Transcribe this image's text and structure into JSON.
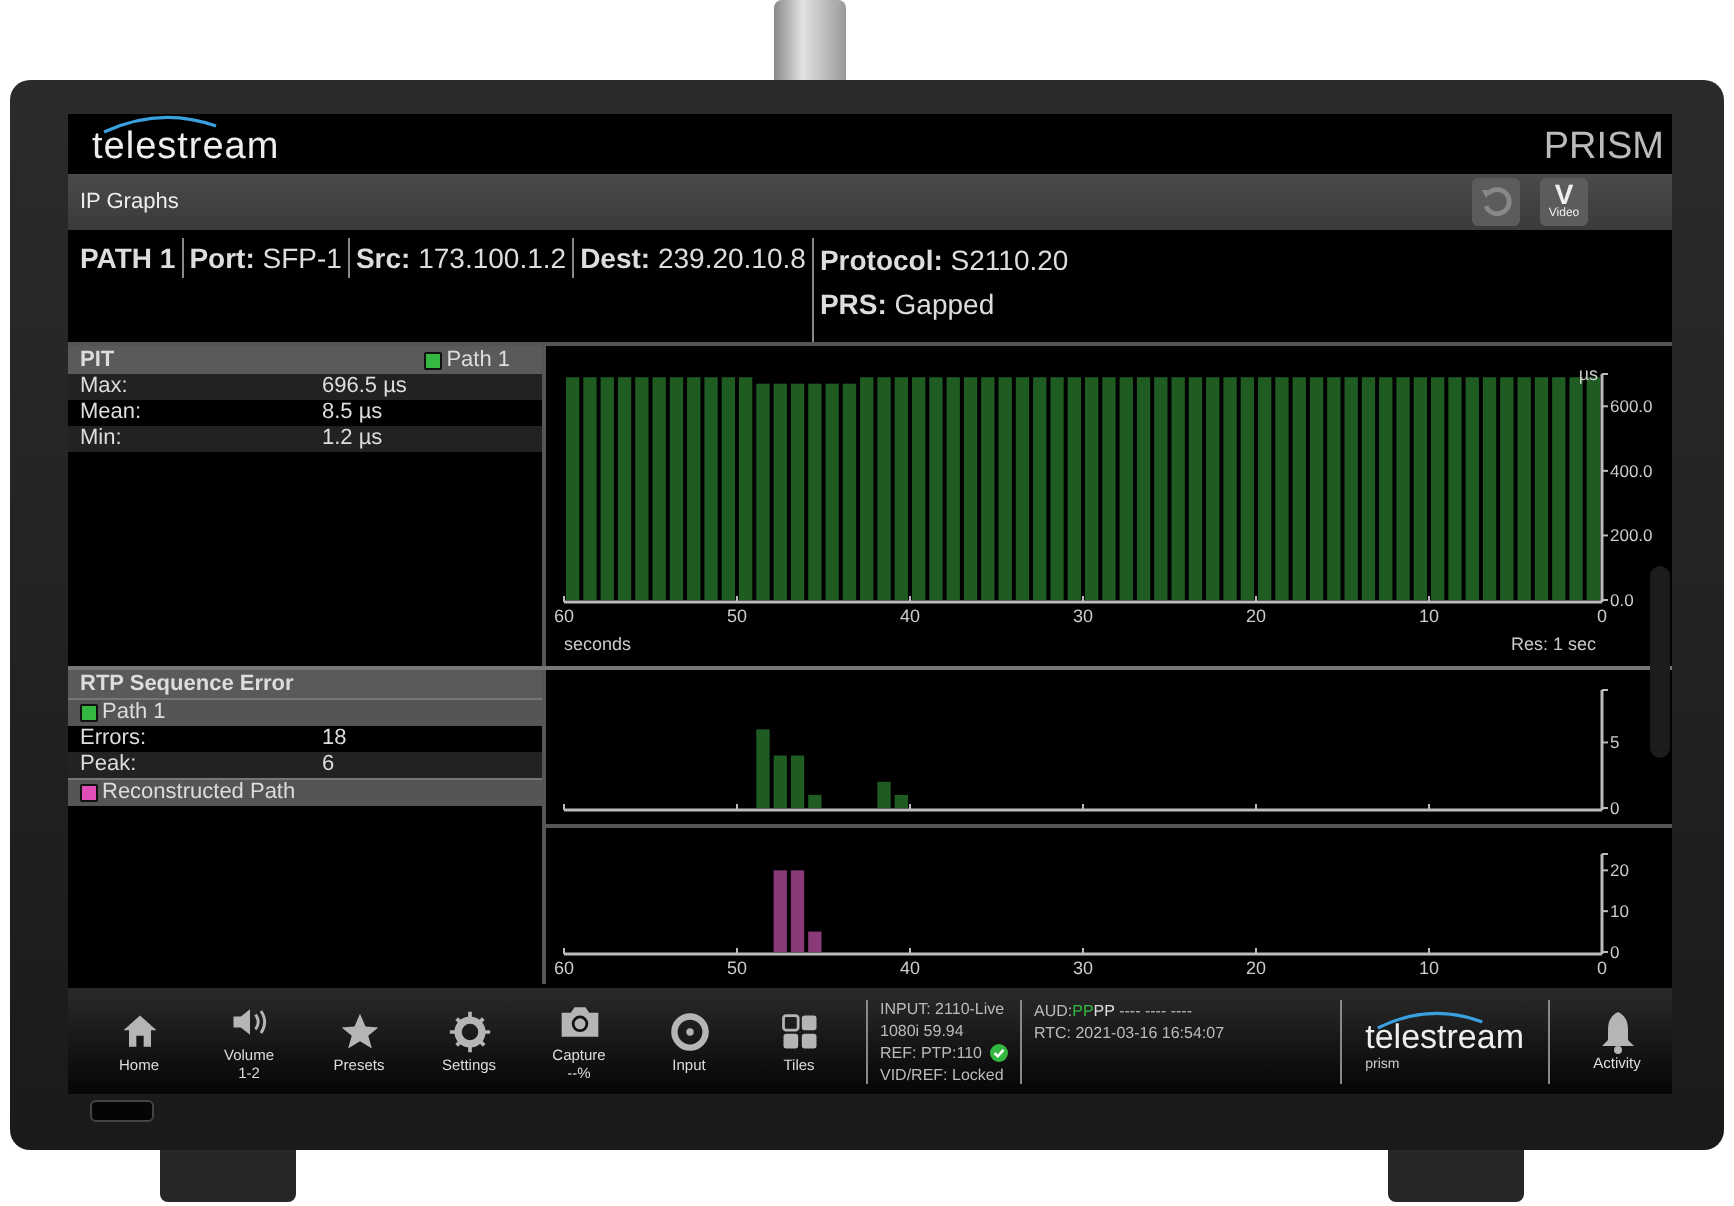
{
  "header": {
    "logo": "telestream",
    "product": "PRISM"
  },
  "title_bar": {
    "title": "IP Graphs",
    "buttons": [
      {
        "kind": "refresh"
      },
      {
        "kind": "video",
        "glyph": "V",
        "label": "Video"
      }
    ]
  },
  "info": {
    "path": "PATH 1",
    "fields": [
      "**Port:** SFP-1",
      "**Src:** 173.100.1.2",
      "**Dest:** 239.20.10.8"
    ],
    "details": [
      "**Protocol:** S2110.20",
      "**PRS:** Gapped"
    ]
  },
  "pit": {
    "title": "PIT",
    "legend": {
      "label": "Path 1",
      "color": "#35b83f"
    },
    "stats": [
      {
        "label": "Max:",
        "value": "696.5 µs"
      },
      {
        "label": "Mean:",
        "value": "8.5 µs"
      },
      {
        "label": "Min:",
        "value": "1.2 µs"
      }
    ],
    "resolution": "Res: 1 sec",
    "chart_data": {
      "type": "bar",
      "xlabel": "seconds",
      "ylabel": "µs",
      "xlim": [
        60,
        0
      ],
      "ylim": [
        0,
        700
      ],
      "xticks": [
        60,
        50,
        40,
        30,
        20,
        10,
        0
      ],
      "yticks": [
        {
          "value": 0,
          "label": "0.0"
        },
        {
          "value": 200,
          "label": "200.0"
        },
        {
          "value": 400,
          "label": "400.0"
        },
        {
          "value": 600,
          "label": "600.0"
        }
      ],
      "x": [
        59.5,
        58.5,
        57.5,
        56.5,
        55.5,
        54.5,
        53.5,
        52.5,
        51.5,
        50.5,
        49.5,
        48.5,
        47.5,
        46.5,
        45.5,
        44.5,
        43.5,
        42.5,
        41.5,
        40.5,
        39.5,
        38.5,
        37.5,
        36.5,
        35.5,
        34.5,
        33.5,
        32.5,
        31.5,
        30.5,
        29.5,
        28.5,
        27.5,
        26.5,
        25.5,
        24.5,
        23.5,
        22.5,
        21.5,
        20.5,
        19.5,
        18.5,
        17.5,
        16.5,
        15.5,
        14.5,
        13.5,
        12.5,
        11.5,
        10.5,
        9.5,
        8.5,
        7.5,
        6.5,
        5.5,
        4.5,
        3.5,
        2.5,
        1.5,
        0.5
      ],
      "series": [
        {
          "color": "#1e5c22",
          "values": [
            690,
            690,
            690,
            690,
            690,
            690,
            690,
            690,
            690,
            690,
            690,
            670,
            670,
            670,
            670,
            670,
            670,
            690,
            690,
            690,
            690,
            690,
            690,
            690,
            690,
            690,
            690,
            690,
            690,
            690,
            690,
            690,
            690,
            690,
            690,
            690,
            690,
            690,
            690,
            690,
            690,
            690,
            690,
            690,
            690,
            690,
            690,
            690,
            690,
            690,
            690,
            690,
            690,
            690,
            690,
            690,
            690,
            690,
            690,
            690
          ]
        }
      ]
    }
  },
  "rtp": {
    "title": "RTP Sequence Error",
    "groups": [
      {
        "label": "Path 1",
        "color": "#35b83f",
        "stats": [
          {
            "label": "Errors:",
            "value": "18"
          },
          {
            "label": "Peak:",
            "value": "6"
          }
        ],
        "chart_data": {
          "type": "bar",
          "xlim": [
            60,
            0
          ],
          "ylim": [
            0,
            9
          ],
          "yticks": [
            {
              "value": 0,
              "label": "0"
            },
            {
              "value": 5,
              "label": "5"
            }
          ],
          "x": [
            48.5,
            47.5,
            46.5,
            45.5,
            41.5,
            40.5
          ],
          "series": [
            {
              "color": "#1e5c22",
              "values": [
                6,
                4,
                4,
                1,
                2,
                1
              ]
            }
          ]
        }
      },
      {
        "label": "Reconstructed Path",
        "color": "#e04fb5",
        "chart_data": {
          "type": "bar",
          "xlim": [
            60,
            0
          ],
          "ylim": [
            0,
            24
          ],
          "xticks": [
            60,
            50,
            40,
            30,
            20,
            10,
            0
          ],
          "yticks": [
            {
              "value": 0,
              "label": "0"
            },
            {
              "value": 10,
              "label": "10"
            },
            {
              "value": 20,
              "label": "20"
            }
          ],
          "x": [
            47.5,
            46.5,
            45.5
          ],
          "series": [
            {
              "color": "#8a3a78",
              "values": [
                20,
                20,
                5
              ]
            }
          ]
        }
      }
    ]
  },
  "nav": [
    {
      "kind": "home",
      "label": "Home"
    },
    {
      "kind": "volume",
      "label": "Volume",
      "sub": "1-2"
    },
    {
      "kind": "presets",
      "label": "Presets"
    },
    {
      "kind": "settings",
      "label": "Settings"
    },
    {
      "kind": "capture",
      "label": "Capture",
      "sub": "--%"
    },
    {
      "kind": "input",
      "label": "Input"
    },
    {
      "kind": "tiles",
      "label": "Tiles"
    }
  ],
  "status": {
    "input": [
      {
        "text": "INPUT: 2110-Live",
        "ok": false
      },
      {
        "text": "1080i 59.94",
        "ok": false
      },
      {
        "text": "REF: PTP:110",
        "ok": true
      },
      {
        "text": "VID/REF: Locked",
        "ok": false
      }
    ],
    "audio": {
      "label": "AUD:",
      "channels": [
        {
          "text": "P",
          "color": "#35b83f"
        },
        {
          "text": "P",
          "color": "#35b83f"
        },
        {
          "text": "P",
          "color": "#dddddd"
        },
        {
          "text": "P",
          "color": "#dddddd"
        }
      ],
      "rest": "---- ---- ----"
    },
    "rtc": "RTC: 2021-03-16 16:54:07"
  },
  "brand": {
    "logo": "telestream",
    "sub": "prism"
  },
  "activity": {
    "label": "Activity"
  }
}
